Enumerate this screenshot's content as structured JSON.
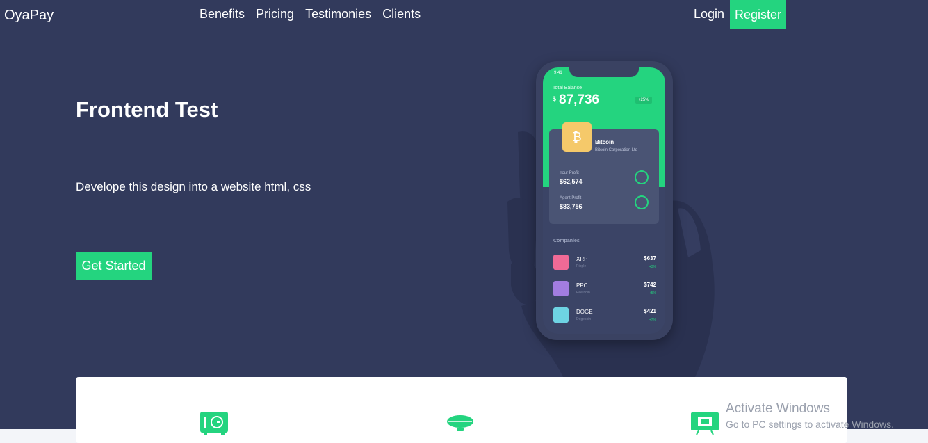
{
  "nav": {
    "brand": "OyaPay",
    "links": [
      "Benefits",
      "Pricing",
      "Testimonies",
      "Clients"
    ],
    "login": "Login",
    "register": "Register"
  },
  "hero": {
    "title": "Frontend Test",
    "subtitle": "Develope this design into a website html, css",
    "cta": "Get Started"
  },
  "phone": {
    "time": "9:41",
    "balance_label": "Total Balance",
    "currency": "$",
    "balance": "87,736",
    "badge": "+25%",
    "coin": {
      "icon": "bitcoin-icon",
      "name": "Bitcoin",
      "corp": "Bitcoin Corporation Ltd",
      "your_profit_label": "Your Profit",
      "your_profit": "$62,574",
      "agent_profit_label": "Agent Profit",
      "agent_profit": "$83,756"
    },
    "companies_label": "Companies",
    "companies": [
      {
        "name": "XRP",
        "sub": "Ripple",
        "value": "$637",
        "change": "+3%",
        "color": "#f06a96",
        "icon": "cocktail-icon"
      },
      {
        "name": "PPC",
        "sub": "Peercoin",
        "value": "$742",
        "change": "+5%",
        "color": "#a27de0",
        "icon": "building-icon"
      },
      {
        "name": "DOGE",
        "sub": "Dogecoin",
        "value": "$421",
        "change": "+7%",
        "color": "#6ed3e3",
        "icon": "bathtub-icon"
      }
    ]
  },
  "features": {
    "icons": [
      "safe-icon",
      "airship-icon",
      "monitor-icon"
    ]
  },
  "watermark": {
    "title": "Activate Windows",
    "subtitle": "Go to PC settings to activate Windows."
  },
  "colors": {
    "accent": "#24d47f",
    "hero_bg": "#323a5c",
    "panel": "#ffffff"
  }
}
